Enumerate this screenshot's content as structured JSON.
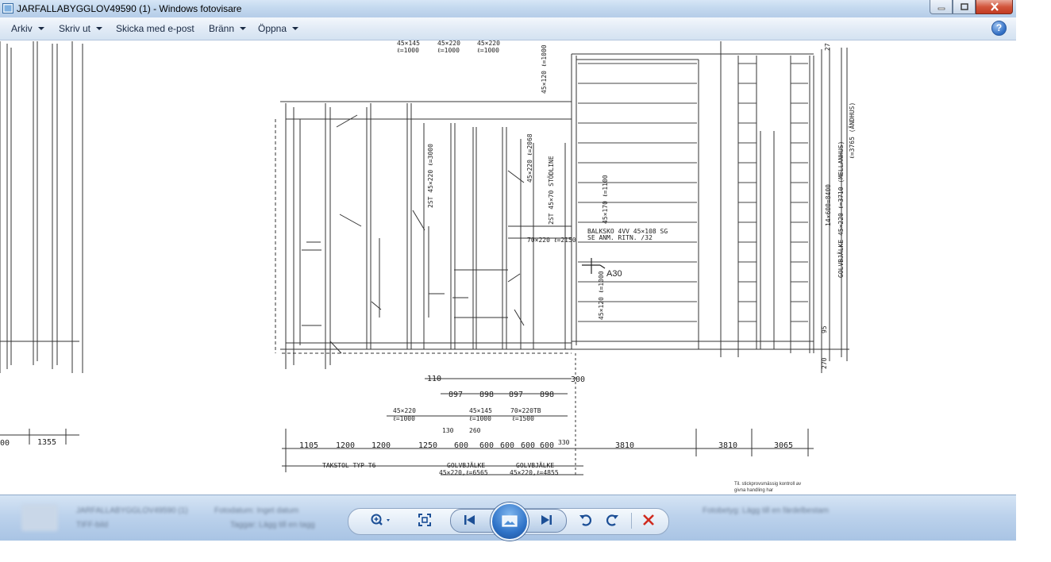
{
  "window": {
    "title": "JARFALLABYGGLOV49590 (1) - Windows fotovisare"
  },
  "menu": {
    "items": [
      {
        "label": "Arkiv",
        "has_dropdown": true
      },
      {
        "label": "Skriv ut",
        "has_dropdown": true
      },
      {
        "label": "Skicka med e-post",
        "has_dropdown": false
      },
      {
        "label": "Bränn",
        "has_dropdown": true
      },
      {
        "label": "Öppna",
        "has_dropdown": true
      }
    ],
    "help_label": "?"
  },
  "drawing": {
    "ref_marker": "A30",
    "top_labels": [
      "45×145",
      "45×220",
      "45×220",
      "ℓ=1000",
      "ℓ=1000",
      "ℓ=1000"
    ],
    "top_vertical_label": "45×120 ℓ=1000",
    "notes": [
      "2ST 45×220 ℓ=3000",
      "45×220 ℓ=2068",
      "2ST 45×70 STÖDLINE",
      "45×170 ℓ=1100",
      "BALKSKO 4VV 45×108 SG",
      "SE ANM. RITN. /32",
      "70×220 ℓ=2150",
      "45×120 ℓ=1000"
    ],
    "right_vertical_labels": [
      "14×600=8400",
      "GOLVBJÄLKE 45×220 ℓ=3710 (MELLANHUS)",
      "ℓ=3765 (ÄNDHUS)"
    ],
    "right_small_dims": [
      "270",
      "95",
      "27"
    ],
    "dims_row_1": [
      "110",
      "300"
    ],
    "dims_row_2": [
      "897",
      "898",
      "897",
      "898"
    ],
    "labels_row_3": [
      {
        "top": "45×220",
        "bottom": "ℓ=1000"
      },
      {
        "top": "45×145",
        "bottom": "ℓ=1000"
      },
      {
        "top": "70×220TB",
        "bottom": "ℓ=1500"
      }
    ],
    "small_dims": [
      "130",
      "260"
    ],
    "dims_row_4": [
      "1105",
      "1200",
      "1200",
      "1250",
      "600",
      "600",
      "600",
      "600",
      "600",
      "330",
      "3810",
      "3810",
      "3065"
    ],
    "left_dims": [
      "00",
      "1355"
    ],
    "bottom_labels": {
      "takstol": "TAKSTOL TYP T6",
      "golv1": "GOLVBJÄLKE",
      "golv1_spec": "45×220,ℓ=6565",
      "golv2": "GOLVBJÄLKE",
      "golv2_spec": "45×220,ℓ=4855"
    },
    "stamp_text": [
      "Til. stickprovsmässig kontroll av",
      "givna handling har"
    ]
  },
  "toolbar": {
    "blurred": {
      "filename": "JARFALLABYGGLOV49590 (1)",
      "meta1": "Fotodatum: Inget datum",
      "type": "TIFF-bild",
      "tags": "Taggar: Lägg till en tagg",
      "props": "Fotobetyg: Lägg till en färdelbestam"
    },
    "colors": {
      "close_red": "#c23b22",
      "bar_blue": "#bcd2ec",
      "accent": "#2f73c8"
    }
  }
}
